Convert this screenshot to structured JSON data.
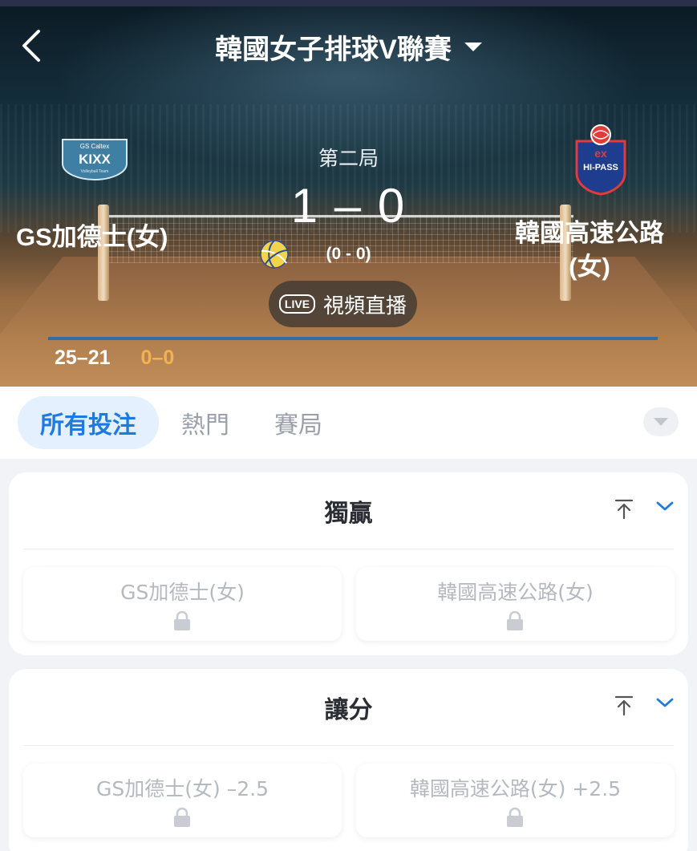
{
  "header": {
    "league_title": "韓國女子排球V聯賽",
    "period": "第二局",
    "score": "1 – 0",
    "sub_score": "(0 - 0)",
    "home_team": "GS加德士(女)",
    "away_team_line1": "韓國高速公路",
    "away_team_line2": "(女)",
    "live_badge": "LIVE",
    "live_label": "視頻直播",
    "set_scores": {
      "completed": "25–21",
      "current": "0–0"
    },
    "home_logo_text": {
      "top": "GS Caltex",
      "main": "KIXX",
      "sub": "Volleyball Team"
    },
    "away_logo_text": {
      "top": "ex",
      "main": "HI-PASS"
    }
  },
  "tabs": [
    {
      "label": "所有投注",
      "active": true
    },
    {
      "label": "熱門",
      "active": false
    },
    {
      "label": "賽局",
      "active": false
    }
  ],
  "markets": [
    {
      "title": "獨贏",
      "options": [
        {
          "label": "GS加德士(女)",
          "locked": true
        },
        {
          "label": "韓國高速公路(女)",
          "locked": true
        }
      ]
    },
    {
      "title": "讓分",
      "options": [
        {
          "label": "GS加德士(女) –2.5",
          "locked": true
        },
        {
          "label": "韓國高速公路(女) +2.5",
          "locked": true
        }
      ]
    }
  ],
  "colors": {
    "accent": "#1d7be0",
    "tab_active_bg": "#e4f0fd",
    "current_set": "#f4b24b"
  }
}
